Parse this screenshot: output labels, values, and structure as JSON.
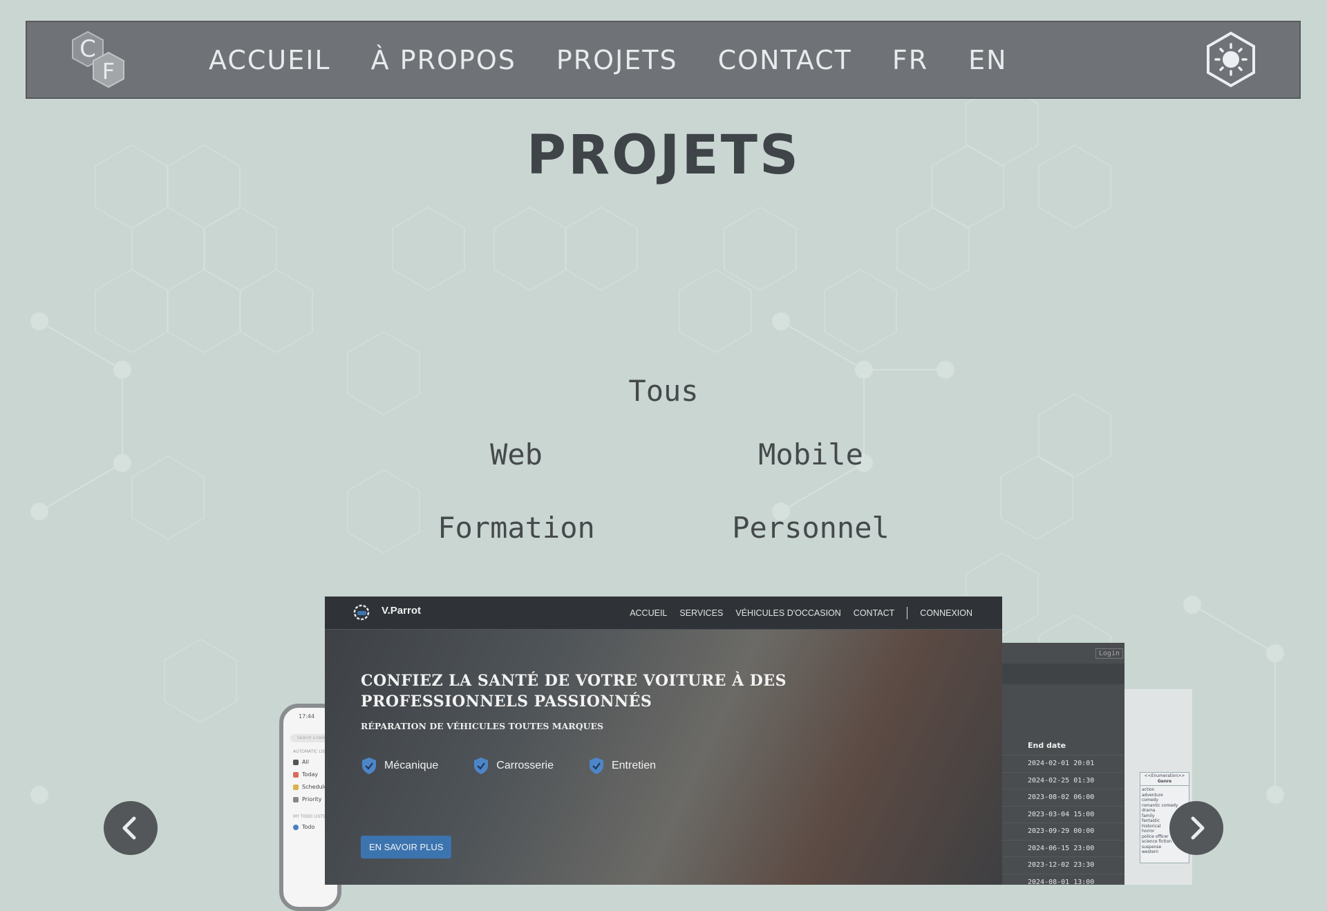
{
  "nav": {
    "logo_letters": "CF",
    "links": [
      "ACCUEIL",
      "À PROPOS",
      "PROJETS",
      "CONTACT",
      "FR",
      "EN"
    ],
    "theme_icon": "sun-icon"
  },
  "page": {
    "title": "PROJETS"
  },
  "filters": {
    "all": "Tous",
    "web": "Web",
    "mobile": "Mobile",
    "training": "Formation",
    "personal": "Personnel"
  },
  "carousel": {
    "prev_icon": "chevron-left-icon",
    "next_icon": "chevron-right-icon",
    "main_shot": {
      "brand": "V.Parrot",
      "nav_links": [
        "ACCUEIL",
        "SERVICES",
        "VÉHICULES D'OCCASION",
        "CONTACT",
        "CONNEXION"
      ],
      "headline": "CONFIEZ LA SANTÉ DE VOTRE VOITURE À DES PROFESSIONNELS PASSIONNÉS",
      "subheadline": "RÉPARATION DE VÉHICULES TOUTES MARQUES",
      "badges": [
        "Mécanique",
        "Carrosserie",
        "Entretien"
      ],
      "cta": "EN SAVOIR PLUS",
      "accent_color": "#3c74b0"
    },
    "phone_shot": {
      "time": "17:44",
      "search_placeholder": "Search a task",
      "section_automatic": "AUTOMATIC LISTS",
      "items": [
        "All",
        "Today",
        "Scheduled",
        "Priority"
      ],
      "section_mylists": "MY TODO LISTS",
      "list_item": "Todo"
    },
    "table_shot": {
      "login": "Login",
      "column_header": "End date",
      "dates": [
        "2024-02-01 20:01",
        "2024-02-25 01:30",
        "2023-08-02 06:00",
        "2023-03-04 15:00",
        "2023-09-29 00:00",
        "2024-06-15 23:00",
        "2023-12-02 23:30",
        "2024-08-01 13:00"
      ]
    },
    "uml_shot": {
      "stereotype": "<<Enumeration>>",
      "name": "Genre",
      "values": [
        "action",
        "adventure",
        "comedy",
        "romantic comedy",
        "drama",
        "family",
        "fantastic",
        "historical",
        "horror",
        "police officer",
        "science fiction",
        "suspense",
        "western"
      ]
    }
  },
  "colors": {
    "background": "#c9d6d1",
    "navbar": "#6f7377",
    "text": "#3f4448"
  }
}
